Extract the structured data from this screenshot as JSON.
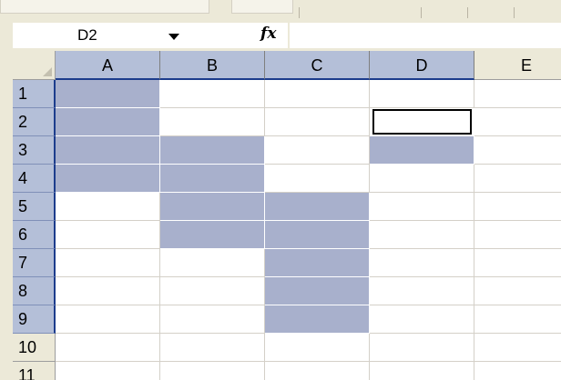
{
  "name_box": {
    "value": "D2"
  },
  "formula_bar": {
    "fx_label": "fx",
    "formula_value": ""
  },
  "columns": [
    "A",
    "B",
    "C",
    "D",
    "E"
  ],
  "rows": [
    "1",
    "2",
    "3",
    "4",
    "5",
    "6",
    "7",
    "8",
    "9",
    "10",
    "11"
  ],
  "active_cell": "D2",
  "selected_ranges": [
    "A1:A4",
    "B3:B6",
    "C5:C9",
    "D2:D3"
  ],
  "colors": {
    "selection": "#a8b0cc",
    "header_highlight": "#b4bfd8",
    "header_border": "#1c3c8c"
  }
}
